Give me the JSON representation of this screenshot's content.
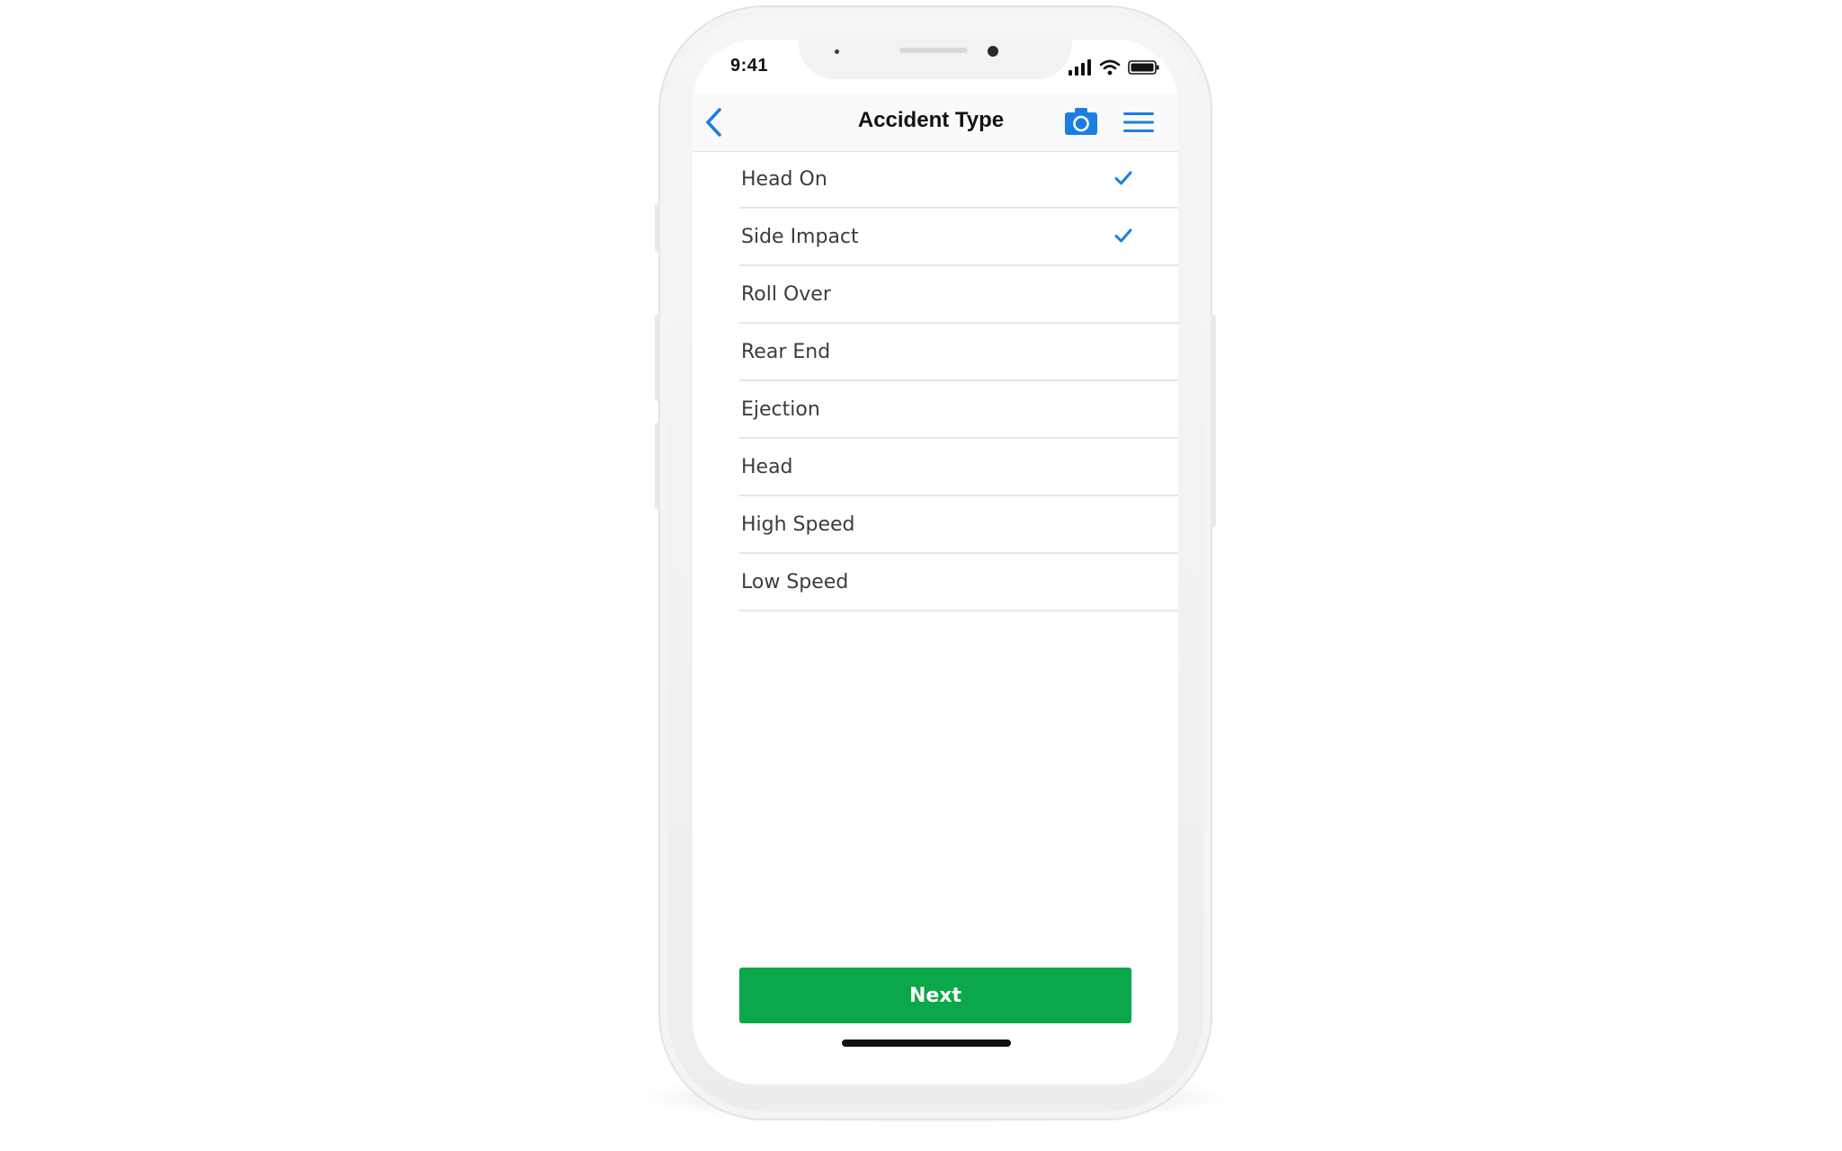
{
  "status_bar": {
    "time": "9:41",
    "icons": [
      "cellular-signal-icon",
      "wifi-icon",
      "battery-icon"
    ]
  },
  "navbar": {
    "title": "Accident Type",
    "back_icon": "chevron-left-icon",
    "camera_icon": "camera-icon",
    "menu_icon": "hamburger-menu-icon"
  },
  "accident_types": [
    {
      "label": "Head On",
      "checked": true
    },
    {
      "label": "Side Impact",
      "checked": true
    },
    {
      "label": "Roll Over",
      "checked": false
    },
    {
      "label": "Rear End",
      "checked": false
    },
    {
      "label": "Ejection",
      "checked": false
    },
    {
      "label": "Head",
      "checked": false
    },
    {
      "label": "High Speed",
      "checked": false
    },
    {
      "label": "Low Speed",
      "checked": false
    }
  ],
  "footer": {
    "next_label": "Next"
  },
  "colors": {
    "accent_blue": "#1a7fe0",
    "next_green": "#0aa84a",
    "checkmark_blue": "#1a7fe0"
  }
}
